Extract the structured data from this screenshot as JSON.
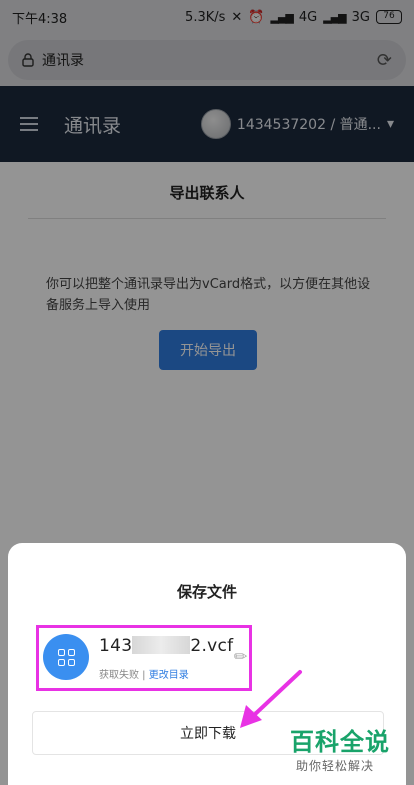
{
  "status_bar": {
    "time": "下午4:38",
    "speed": "5.3K/s",
    "network1": "4G",
    "network2": "3G",
    "battery": "76"
  },
  "browser": {
    "url_text": "通讯录"
  },
  "navbar": {
    "title": "通讯录",
    "user": "1434537202 / 普通..."
  },
  "content": {
    "title": "导出联系人",
    "description": "你可以把整个通讯录导出为vCard格式，以方便在其他设备服务上导入使用",
    "export_button": "开始导出"
  },
  "sheet": {
    "title": "保存文件",
    "file_name_prefix": "143",
    "file_name_suffix": "2.vcf",
    "status": "获取失败",
    "separator": " | ",
    "change_dir": "更改目录",
    "download_button": "立即下载"
  },
  "watermark": {
    "title": "百科全说",
    "subtitle": "助你轻松解决"
  },
  "colors": {
    "accent": "#2f7de1",
    "highlight": "#e832e4",
    "navbar": "#1d2a3d",
    "watermark": "#19a36a"
  }
}
